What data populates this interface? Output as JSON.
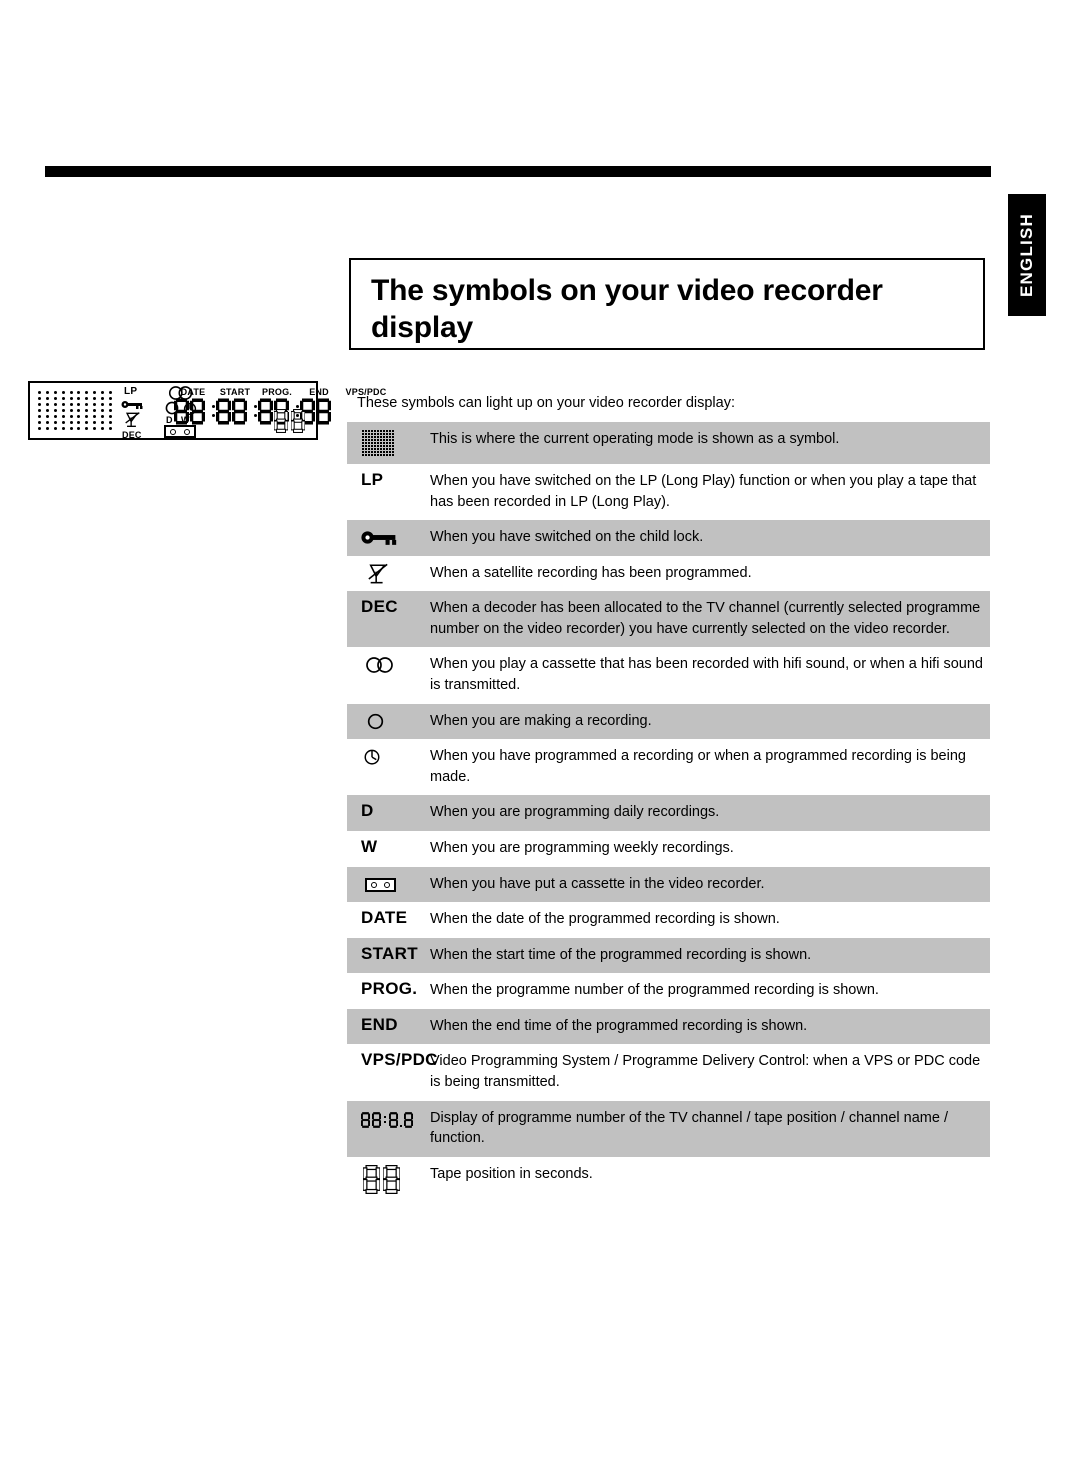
{
  "page": {
    "language_tab": "ENGLISH",
    "title": "The symbols on your video recorder display",
    "intro": "These symbols can light up on your video recorder display:"
  },
  "lcd_illustration": {
    "labels": {
      "lp": "LP",
      "dec": "DEC",
      "dw": "D W",
      "date": "DATE",
      "start": "START",
      "prog": "PROG.",
      "end": "END",
      "vps_pdc": "VPS/PDC"
    },
    "icons": [
      "dot-matrix",
      "lp-text",
      "key-icon",
      "satellite-dish-icon",
      "dec-text",
      "hifi-icon",
      "record-icon",
      "timer-icon",
      "daily-weekly-text",
      "cassette-icon",
      "seven-segment-digits"
    ]
  },
  "table": {
    "rows": [
      {
        "symbol_type": "dot-matrix",
        "symbol_label": "",
        "description": "This is where the current operating mode is shown as a symbol.",
        "shaded": true
      },
      {
        "symbol_type": "text",
        "symbol_label": "LP",
        "description": "When you have switched on the LP (Long Play) function or when you play a tape that has been recorded in LP (Long Play).",
        "shaded": false
      },
      {
        "symbol_type": "key-icon",
        "symbol_label": "",
        "description": "When you have switched on the child lock.",
        "shaded": true
      },
      {
        "symbol_type": "satellite-dish-icon",
        "symbol_label": "",
        "description": "When a satellite recording has been programmed.",
        "shaded": false
      },
      {
        "symbol_type": "text",
        "symbol_label": "DEC",
        "description": "When a decoder has been allocated to the TV channel (currently selected programme number on the video recorder) you have currently selected on the video recorder.",
        "shaded": true
      },
      {
        "symbol_type": "hifi-icon",
        "symbol_label": "",
        "description": "When you play a cassette that has been recorded with hifi sound, or when a hifi sound is transmitted.",
        "shaded": false
      },
      {
        "symbol_type": "record-icon",
        "symbol_label": "",
        "description": "When you are making a recording.",
        "shaded": true
      },
      {
        "symbol_type": "timer-icon",
        "symbol_label": "",
        "description": "When you have programmed a recording or when a programmed recording is being made.",
        "shaded": false
      },
      {
        "symbol_type": "text",
        "symbol_label": "D",
        "description": "When you are programming daily recordings.",
        "shaded": true
      },
      {
        "symbol_type": "text",
        "symbol_label": "W",
        "description": "When you are programming weekly recordings.",
        "shaded": false
      },
      {
        "symbol_type": "cassette-icon",
        "symbol_label": "",
        "description": "When you have put a cassette in the video recorder.",
        "shaded": true
      },
      {
        "symbol_type": "text",
        "symbol_label": "DATE",
        "description": "When the date of the programmed recording is shown.",
        "shaded": false
      },
      {
        "symbol_type": "text",
        "symbol_label": "START",
        "description": "When the start time of the programmed recording is shown.",
        "shaded": true
      },
      {
        "symbol_type": "text",
        "symbol_label": "PROG.",
        "description": "When the programme number of the programmed recording is shown.",
        "shaded": false
      },
      {
        "symbol_type": "text",
        "symbol_label": "END",
        "description": "When the end time of the programmed recording is shown.",
        "shaded": true
      },
      {
        "symbol_type": "text",
        "symbol_label": "VPS/PDC",
        "description": "Video Programming System / Programme Delivery Control: when a VPS or PDC code is being transmitted.",
        "shaded": false
      },
      {
        "symbol_type": "seven-segment-small",
        "symbol_label": "",
        "description": "Display of programme number of the TV channel / tape position / channel name / function.",
        "shaded": true
      },
      {
        "symbol_type": "seven-segment-large",
        "symbol_label": "",
        "description": "Tape position in seconds.",
        "shaded": false
      }
    ]
  },
  "colors": {
    "row_shaded": "#c1c1c1",
    "row_plain": "#ffffff",
    "ink": "#000000",
    "tab_bg": "#000000",
    "tab_text": "#ffffff"
  }
}
